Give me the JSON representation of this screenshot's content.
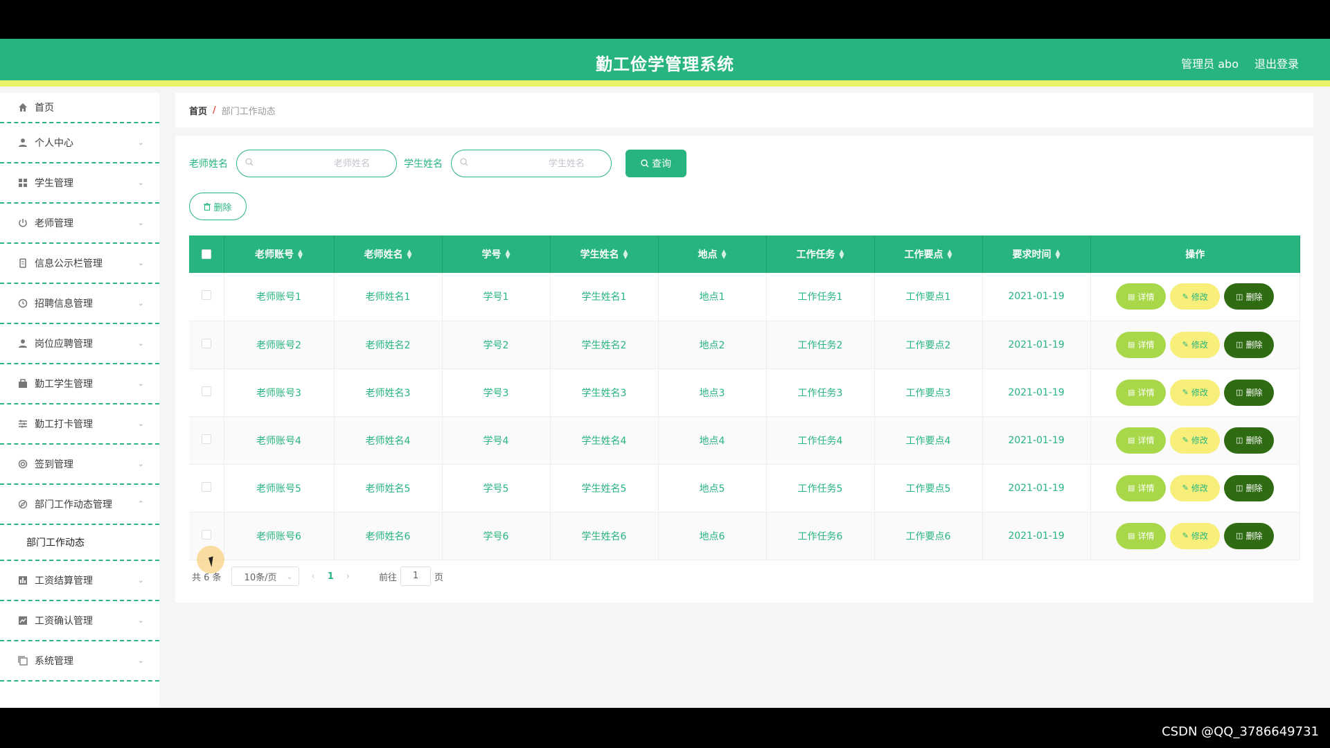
{
  "header": {
    "title": "勤工俭学管理系统",
    "user": "管理员 abo",
    "logout": "退出登录"
  },
  "colors": {
    "primary": "#27b47f",
    "accent_strip": "#e9f46a",
    "detail_btn": "#a8d84a",
    "edit_btn": "#f7ef7a",
    "delete_btn": "#2f6b12"
  },
  "sidebar": {
    "items": [
      {
        "label": "首页",
        "icon": "home-icon"
      },
      {
        "label": "个人中心",
        "icon": "user-icon"
      },
      {
        "label": "学生管理",
        "icon": "grid-icon"
      },
      {
        "label": "老师管理",
        "icon": "power-icon"
      },
      {
        "label": "信息公示栏管理",
        "icon": "file-icon"
      },
      {
        "label": "招聘信息管理",
        "icon": "clock-icon"
      },
      {
        "label": "岗位应聘管理",
        "icon": "person-icon"
      },
      {
        "label": "勤工学生管理",
        "icon": "briefcase-icon"
      },
      {
        "label": "勤工打卡管理",
        "icon": "sliders-icon"
      },
      {
        "label": "签到管理",
        "icon": "target-icon"
      },
      {
        "label": "部门工作动态管理",
        "icon": "compass-icon"
      },
      {
        "label": "工资结算管理",
        "icon": "bar-chart-icon"
      },
      {
        "label": "工资确认管理",
        "icon": "line-chart-icon"
      },
      {
        "label": "系统管理",
        "icon": "copy-icon"
      }
    ],
    "submenu_label": "部门工作动态"
  },
  "breadcrumb": {
    "home": "首页",
    "separator": "/",
    "current": "部门工作动态"
  },
  "search": {
    "teacher_label": "老师姓名",
    "teacher_placeholder": "老师姓名",
    "student_label": "学生姓名",
    "student_placeholder": "学生姓名",
    "button": "查询"
  },
  "toolbar": {
    "delete_label": "删除"
  },
  "table": {
    "columns": [
      "老师账号",
      "老师姓名",
      "学号",
      "学生姓名",
      "地点",
      "工作任务",
      "工作要点",
      "要求时间",
      "操作"
    ],
    "rows": [
      [
        "老师账号1",
        "老师姓名1",
        "学号1",
        "学生姓名1",
        "地点1",
        "工作任务1",
        "工作要点1",
        "2021-01-19"
      ],
      [
        "老师账号2",
        "老师姓名2",
        "学号2",
        "学生姓名2",
        "地点2",
        "工作任务2",
        "工作要点2",
        "2021-01-19"
      ],
      [
        "老师账号3",
        "老师姓名3",
        "学号3",
        "学生姓名3",
        "地点3",
        "工作任务3",
        "工作要点3",
        "2021-01-19"
      ],
      [
        "老师账号4",
        "老师姓名4",
        "学号4",
        "学生姓名4",
        "地点4",
        "工作任务4",
        "工作要点4",
        "2021-01-19"
      ],
      [
        "老师账号5",
        "老师姓名5",
        "学号5",
        "学生姓名5",
        "地点5",
        "工作任务5",
        "工作要点5",
        "2021-01-19"
      ],
      [
        "老师账号6",
        "老师姓名6",
        "学号6",
        "学生姓名6",
        "地点6",
        "工作任务6",
        "工作要点6",
        "2021-01-19"
      ]
    ],
    "actions": {
      "detail": "详情",
      "edit": "修改",
      "delete": "删除"
    }
  },
  "pagination": {
    "total": "共 6 条",
    "page_size": "10条/页",
    "current_page": "1",
    "goto_prefix": "前往",
    "goto_value": "1",
    "goto_suffix": "页"
  },
  "watermark": "CSDN @QQ_3786649731"
}
